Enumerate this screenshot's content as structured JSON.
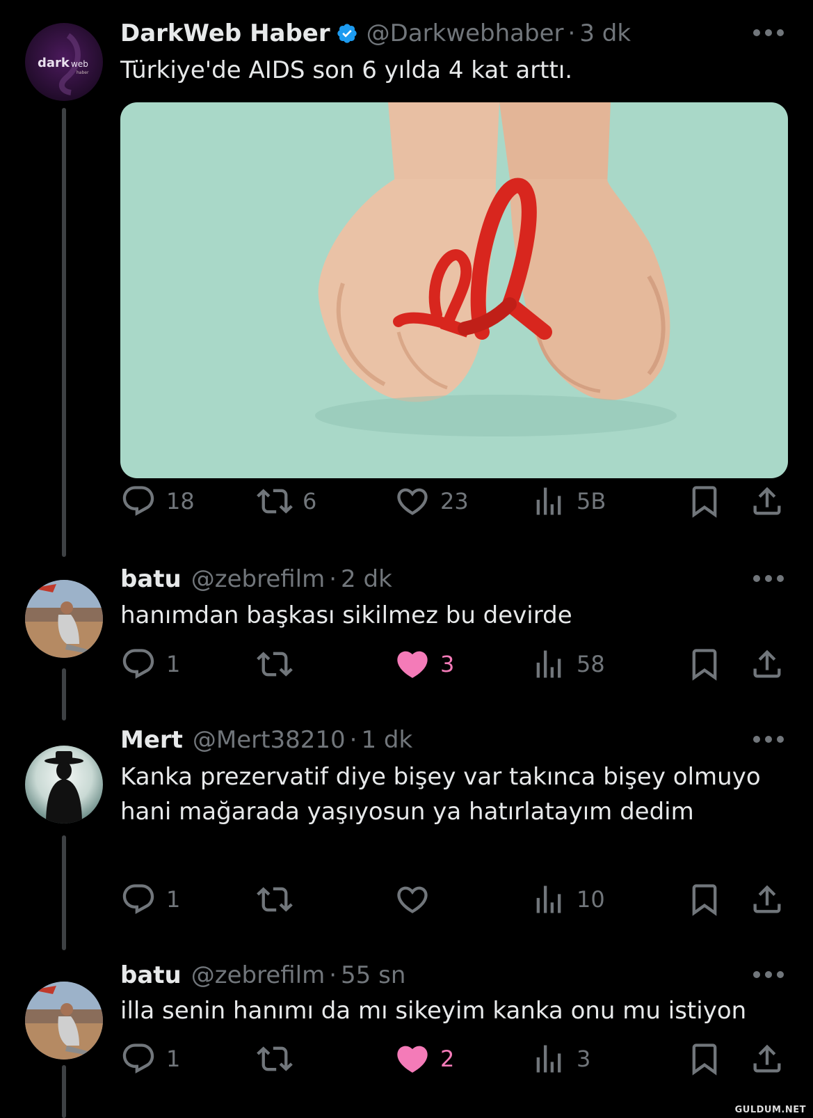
{
  "tweets": [
    {
      "name": "DarkWeb Haber",
      "verified": true,
      "handle": "@Darkwebhaber",
      "time": "3 dk",
      "text": "Türkiye'de AIDS son 6 yılda 4 kat arttı.",
      "avatar_text": "darkweb",
      "avatar_subtext": "haber",
      "has_media": true,
      "media_alt": "hands-holding-red-ribbons",
      "replies": "18",
      "retweets": "6",
      "likes": "23",
      "liked": false,
      "views": "5B"
    },
    {
      "name": "batu",
      "verified": false,
      "handle": "@zebrefilm",
      "time": "2 dk",
      "text": "hanımdan başkası sikilmez bu devirde",
      "replies": "1",
      "retweets": "",
      "likes": "3",
      "liked": true,
      "views": "58"
    },
    {
      "name": "Mert",
      "verified": false,
      "handle": "@Mert38210",
      "time": "1 dk",
      "text": "Kanka prezervatif diye bişey var takınca bişey olmuyo hani mağarada yaşıyosun ya hatırlatayım dedim",
      "replies": "1",
      "retweets": "",
      "likes": "",
      "liked": false,
      "views": "10"
    },
    {
      "name": "batu",
      "verified": false,
      "handle": "@zebrefilm",
      "time": "55 sn",
      "text": "illa senin hanımı da mı sikeyim kanka onu mu istiyon",
      "replies": "1",
      "retweets": "",
      "likes": "2",
      "liked": true,
      "views": "3"
    }
  ],
  "separator": "·",
  "watermark": "GULDUM.NET",
  "colors": {
    "background": "#000000",
    "primary_text": "#e7e9ea",
    "secondary_text": "#71767b",
    "like_pink": "#f91880",
    "verified_blue": "#1d9bf0",
    "media_bg": "#a9d8c8",
    "ribbon_red": "#d8261e"
  },
  "icons": [
    "reply-icon",
    "retweet-icon",
    "like-icon",
    "views-icon",
    "bookmark-icon",
    "share-icon",
    "more-icon",
    "verified-icon"
  ]
}
